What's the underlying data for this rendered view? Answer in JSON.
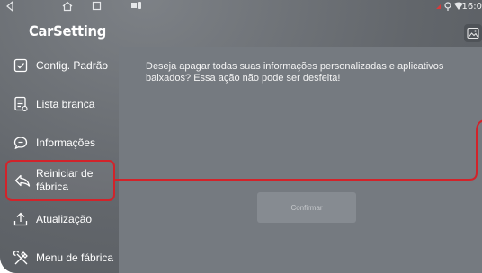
{
  "statusbar": {
    "time": "16:0",
    "nav_icons": [
      "back-triangle-icon",
      "home-icon",
      "recents-square-icon"
    ],
    "indicator_icons": [
      "wifi-icon",
      "location-icon",
      "battery-icon"
    ]
  },
  "app": {
    "title": "CarSetting"
  },
  "sidebar": {
    "items": [
      {
        "label": "Config. Padrão",
        "icon": "checkbox-icon",
        "active": false
      },
      {
        "label": "Lista branca",
        "icon": "document-list-icon",
        "active": false
      },
      {
        "label": "Informações",
        "icon": "chat-bubble-icon",
        "active": false
      },
      {
        "label": "Reiniciar de fábrica",
        "icon": "reply-arrow-icon",
        "active": true
      },
      {
        "label": "Atualização",
        "icon": "upload-icon",
        "active": false
      },
      {
        "label": "Menu de fábrica",
        "icon": "tools-icon",
        "active": false
      }
    ]
  },
  "panel": {
    "message": "Deseja apagar todas suas informações personalizadas e aplicativos baixados? Essa ação não pode ser desfeita!",
    "confirm_label": "Confirmar"
  },
  "colors": {
    "background": "#666a6f",
    "panel": "#757a80",
    "highlight": "#d2232a",
    "text": "#ffffff"
  }
}
